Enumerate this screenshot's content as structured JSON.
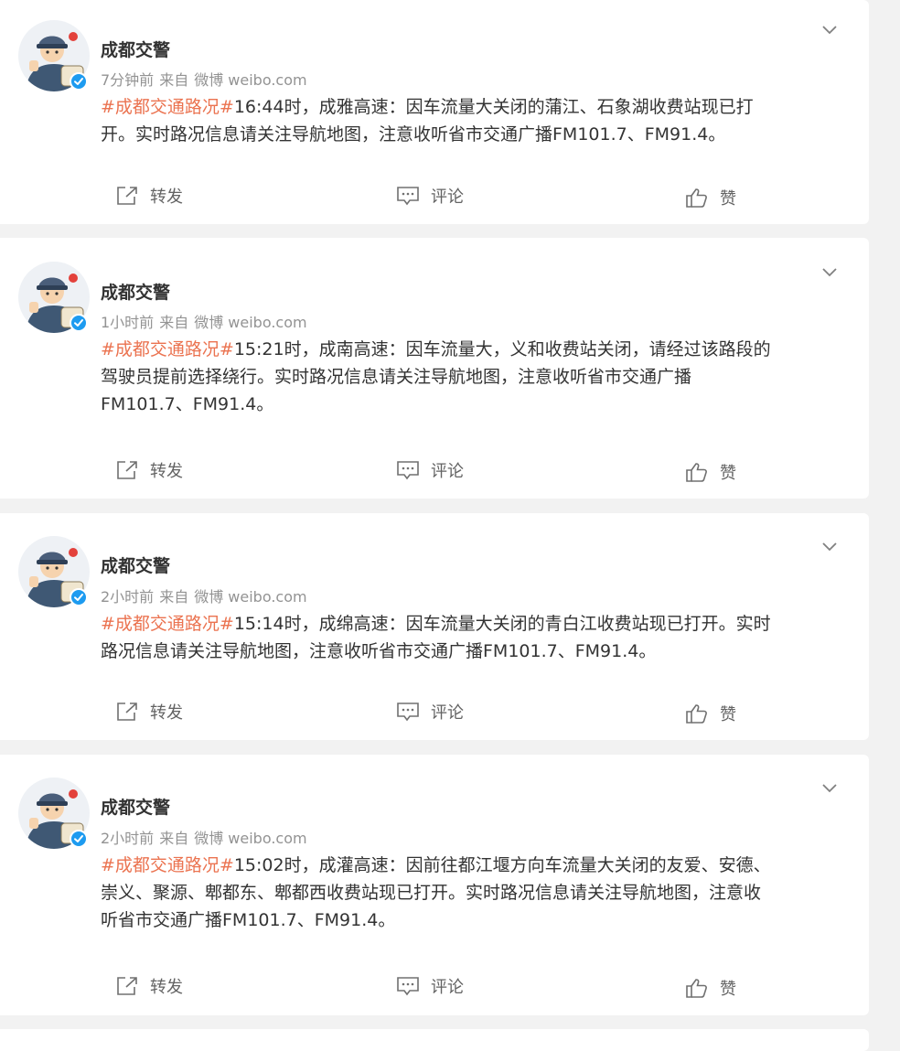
{
  "posts": [
    {
      "author": "成都交警",
      "time": "7分钟前",
      "source_prefix": "来自",
      "source": "微博 weibo.com",
      "hashtag": "#成都交通路况#",
      "lines": [
        "16:44时，成雅高速：因车流量大关闭的蒲江、石象湖收费站现已打",
        "开。实时路况信息请关注导航地图，注意收听省市交通广播FM101.7、FM91.4。"
      ],
      "repost": "转发",
      "comment": "评论",
      "like": "赞"
    },
    {
      "author": "成都交警",
      "time": "1小时前",
      "source_prefix": "来自",
      "source": "微博 weibo.com",
      "hashtag": "#成都交通路况#",
      "lines": [
        "15:21时，成南高速：因车流量大，义和收费站关闭，请经过该路段的",
        "驾驶员提前选择绕行。实时路况信息请关注导航地图，注意收听省市交通广播",
        "FM101.7、FM91.4。"
      ],
      "repost": "转发",
      "comment": "评论",
      "like": "赞"
    },
    {
      "author": "成都交警",
      "time": "2小时前",
      "source_prefix": "来自",
      "source": "微博 weibo.com",
      "hashtag": "#成都交通路况#",
      "lines": [
        "15:14时，成绵高速：因车流量大关闭的青白江收费站现已打开。实时",
        "路况信息请关注导航地图，注意收听省市交通广播FM101.7、FM91.4。"
      ],
      "repost": "转发",
      "comment": "评论",
      "like": "赞"
    },
    {
      "author": "成都交警",
      "time": "2小时前",
      "source_prefix": "来自",
      "source": "微博 weibo.com",
      "hashtag": "#成都交通路况#",
      "lines": [
        "15:02时，成灌高速：因前往都江堰方向车流量大关闭的友爱、安德、",
        "崇义、聚源、郫都东、郫都西收费站现已打开。实时路况信息请关注导航地图，注意收",
        "听省市交通广播FM101.7、FM91.4。"
      ],
      "repost": "转发",
      "comment": "评论",
      "like": "赞"
    }
  ],
  "colors": {
    "hashtag": "#eb7350",
    "text": "#333333",
    "meta": "#939393",
    "background": "#f2f2f2",
    "verified": "#1d9bf0"
  },
  "icons": {
    "more": "chevron-down-icon",
    "repost": "repost-icon",
    "comment": "comment-icon",
    "like": "thumbs-up-icon",
    "verified": "verified-badge-icon"
  }
}
